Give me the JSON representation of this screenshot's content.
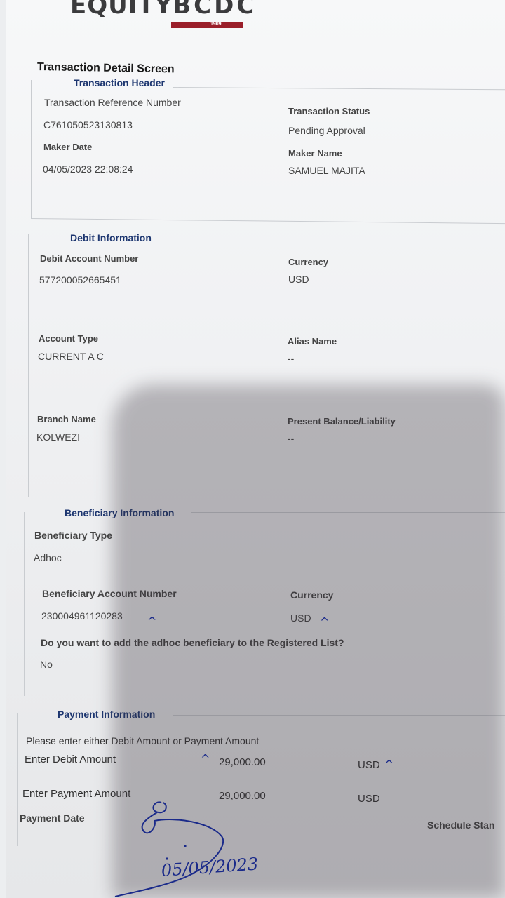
{
  "logo": {
    "equity": "EQUITY",
    "bcdc": "BCDC",
    "year": "1909"
  },
  "page_title": "Transaction Detail Screen",
  "transaction_header": {
    "title": "Transaction Header",
    "ref_label": "Transaction Reference Number",
    "ref_value": "C761050523130813",
    "status_label": "Transaction Status",
    "status_value": "Pending Approval",
    "maker_date_label": "Maker Date",
    "maker_date_value": "04/05/2023 22:08:24",
    "maker_name_label": "Maker Name",
    "maker_name_value": "SAMUEL MAJITA"
  },
  "debit_information": {
    "title": "Debit Information",
    "account_number_label": "Debit Account Number",
    "account_number_value": "577200052665451",
    "currency_label": "Currency",
    "currency_value": "USD",
    "account_type_label": "Account Type",
    "account_type_value": "CURRENT A C",
    "alias_label": "Alias Name",
    "alias_value": "--",
    "branch_label": "Branch Name",
    "branch_value": "KOLWEZI",
    "balance_label": "Present Balance/Liability",
    "balance_value": "--"
  },
  "beneficiary_information": {
    "title": "Beneficiary Information",
    "type_label": "Beneficiary Type",
    "type_value": "Adhoc",
    "account_number_label": "Beneficiary Account Number",
    "account_number_value": "230004961120283",
    "currency_label": "Currency",
    "currency_value": "USD",
    "question": "Do you want to add the adhoc beneficiary to the Registered List?",
    "answer": "No"
  },
  "payment_information": {
    "title": "Payment Information",
    "instruction": "Please enter either Debit Amount or Payment Amount",
    "debit_amount_label": "Enter Debit Amount",
    "debit_amount_value": "29,000.00",
    "debit_currency": "USD",
    "payment_amount_label": "Enter Payment Amount",
    "payment_amount_value": "29,000.00",
    "payment_currency": "USD",
    "payment_date_label": "Payment Date",
    "schedule_label": "Schedule Stan"
  },
  "handwriting": {
    "date": "05/05/2023"
  },
  "colors": {
    "brand_red": "#9a1f2a",
    "section_blue": "#1d3670",
    "ink_blue": "#1a2a8a"
  }
}
